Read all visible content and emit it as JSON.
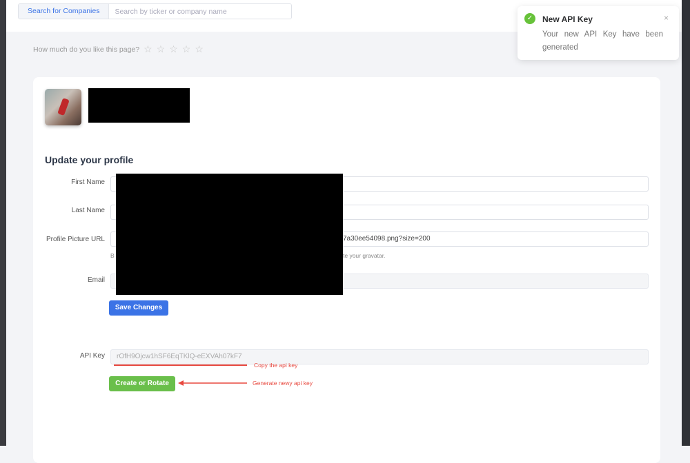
{
  "header": {
    "search_label": "Search for Companies",
    "search_placeholder": "Search by ticker or company name"
  },
  "rating": {
    "prompt": "How much do you like this page?",
    "stars": 5,
    "value": 0
  },
  "toast": {
    "icon": "check-circle-icon",
    "title": "New API Key",
    "message": "Your new API Key have been generated",
    "close": "×"
  },
  "profile": {
    "title": "Update your profile",
    "first_name_label": "First Name",
    "last_name_label": "Last Name",
    "picture_label": "Profile Picture URL",
    "picture_value": "7a30ee54098.png?size=200",
    "picture_help_start": "B",
    "picture_help_end": "te your gravatar.",
    "email_label": "Email",
    "save_label": "Save Changes",
    "api_key_label": "API Key",
    "api_key_value": "rOfH9Ojcw1hSF6EqTKlQ-eEXVAh07kF7",
    "create_label": "Create or Rotate"
  },
  "annotations": {
    "copy": "Copy the api key",
    "generate": "Generate newy api key",
    "color": "#e8483e"
  },
  "colors": {
    "primary": "#3b73e6",
    "success": "#6abf4b"
  }
}
